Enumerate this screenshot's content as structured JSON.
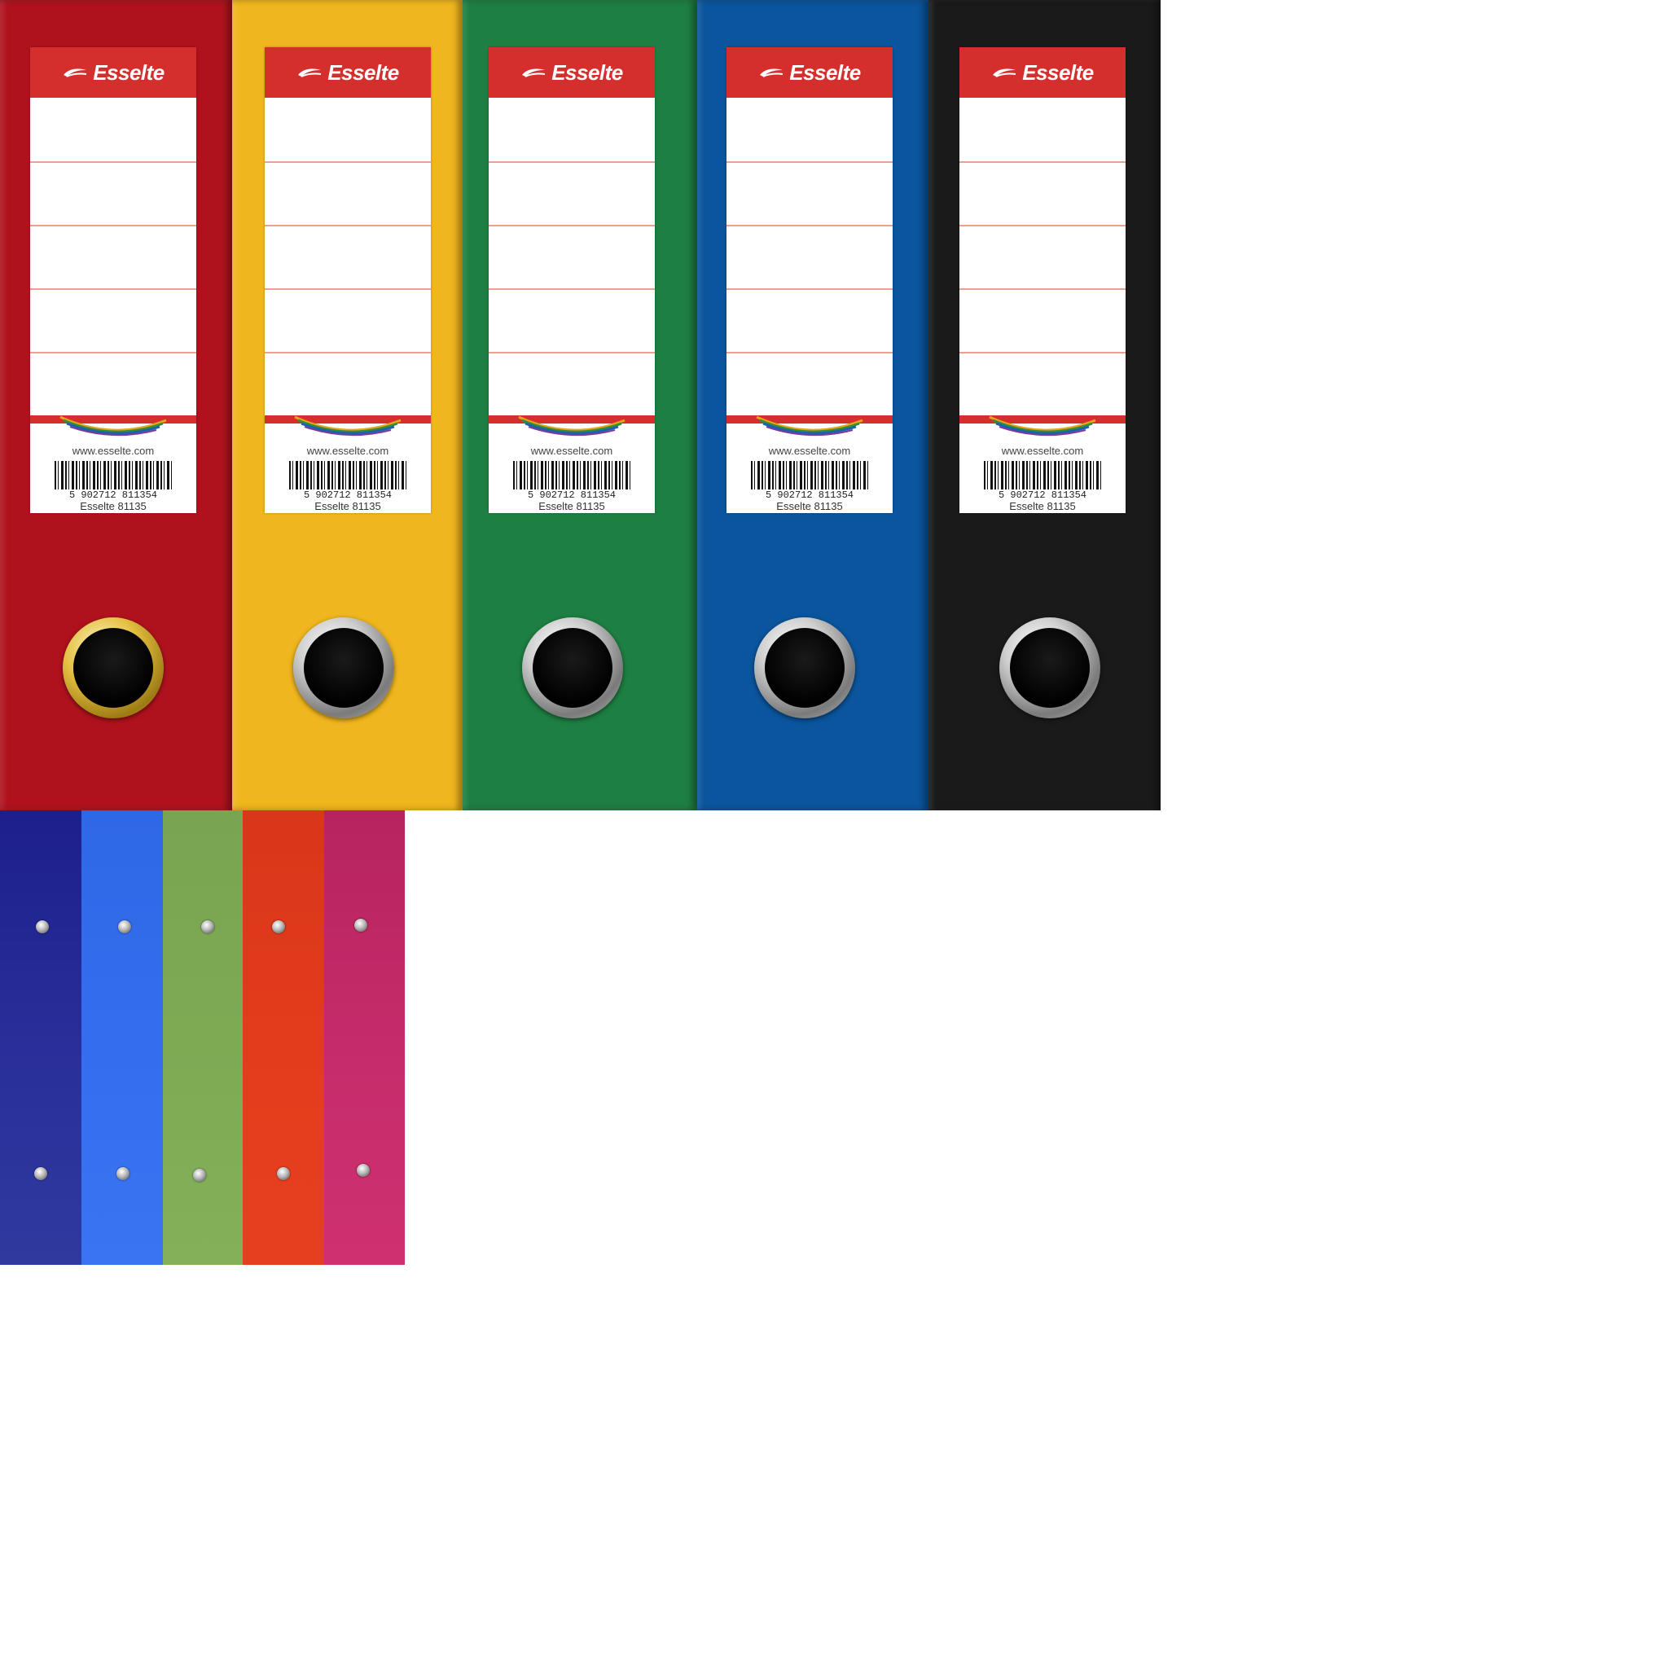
{
  "label": {
    "brand": "Esselte",
    "website": "www.esselte.com",
    "barcode_number": "5 902712 811354",
    "model": "Esselte 81135"
  },
  "binders_top": [
    {
      "name": "red",
      "color": "#b0121d",
      "ring": "gold"
    },
    {
      "name": "yellow",
      "color": "#f0b61e",
      "ring": "silver"
    },
    {
      "name": "green",
      "color": "#1e7f42",
      "ring": "silver"
    },
    {
      "name": "blue",
      "color": "#0a559d",
      "ring": "silver"
    },
    {
      "name": "black",
      "color": "#1a1a1a",
      "ring": "silver"
    }
  ],
  "spines_bottom": [
    {
      "name": "navy",
      "color": "#24238f"
    },
    {
      "name": "blue",
      "color": "#2f6cec"
    },
    {
      "name": "olive",
      "color": "#7aa552"
    },
    {
      "name": "orange",
      "color": "#e0391b"
    },
    {
      "name": "magenta",
      "color": "#c02a68"
    }
  ]
}
